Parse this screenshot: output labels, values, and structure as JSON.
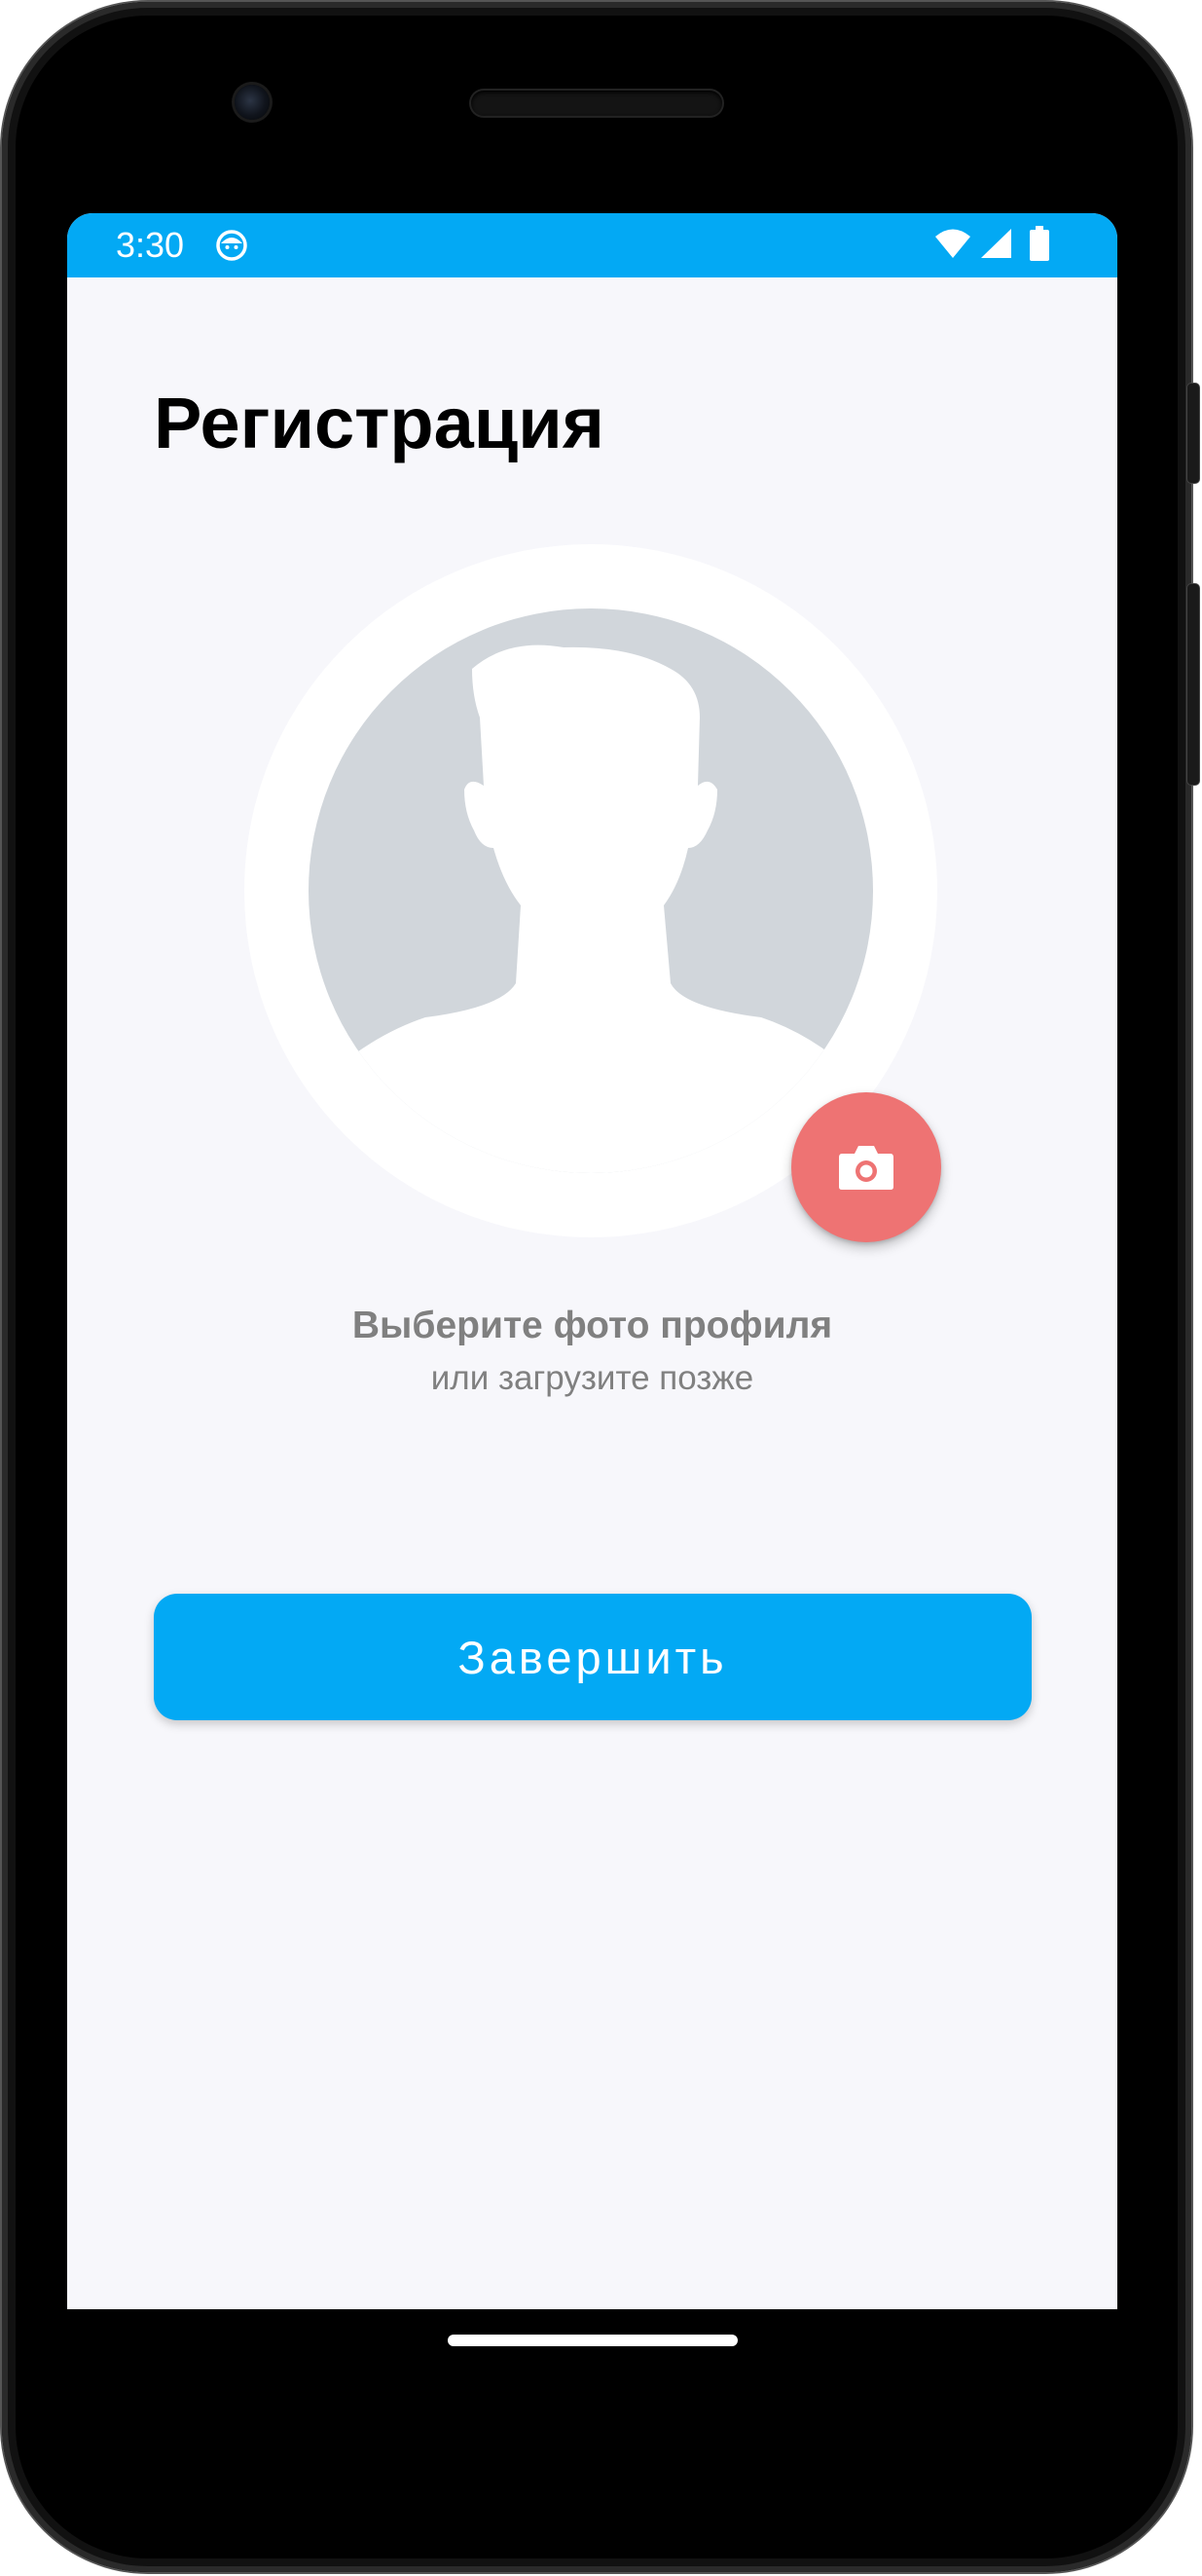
{
  "status_bar": {
    "time": "3:30",
    "app_icon": "notification-app-icon",
    "icons": [
      "wifi-icon",
      "signal-icon",
      "battery-icon"
    ],
    "background_color": "#03a9f4"
  },
  "page": {
    "title": "Регистрация"
  },
  "avatar": {
    "placeholder_icon": "person-silhouette-icon",
    "camera_button_icon": "camera-icon",
    "camera_button_color": "#ee7373"
  },
  "caption": {
    "title": "Выберите фото профиля",
    "subtitle": "или загрузите позже"
  },
  "actions": {
    "finish_label": "Завершить",
    "accent_color": "#03a9f4"
  }
}
